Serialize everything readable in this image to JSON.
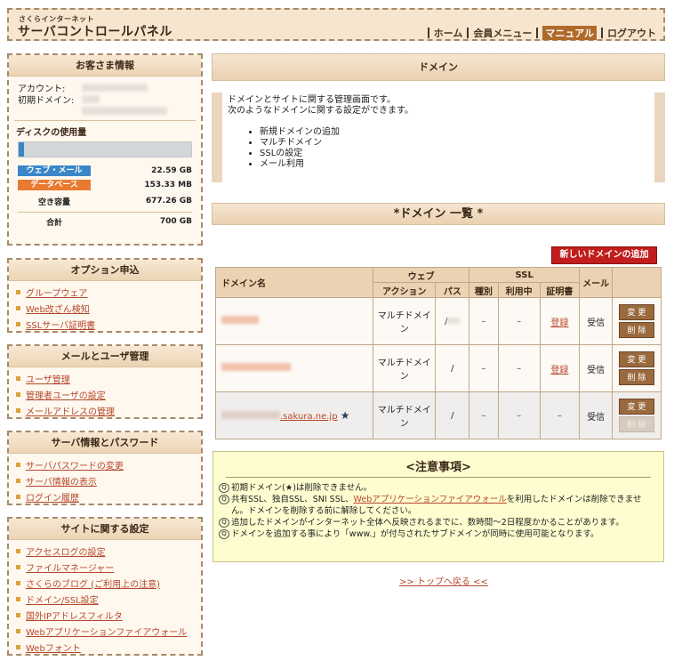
{
  "header": {
    "logo_small": "さくらインターネット",
    "logo_main": "サーバコントロールパネル",
    "nav": [
      {
        "label": "ホーム",
        "active": false
      },
      {
        "label": "会員メニュー",
        "active": false
      },
      {
        "label": "マニュアル",
        "active": true
      },
      {
        "label": "ログアウト",
        "active": false
      }
    ]
  },
  "customer": {
    "title": "お客さま情報",
    "account_label": "アカウント:",
    "initial_domain_label": "初期ドメイン:",
    "disk_title": "ディスクの使用量",
    "disk_usage_fraction": 0.03,
    "disk_rows": [
      {
        "label": "ウェブ・メール",
        "value": "22.59 GB",
        "color": "#3a86c8"
      },
      {
        "label": "データベース",
        "value": "153.33 MB",
        "color": "#e87a30"
      }
    ],
    "free_label": "空き容量",
    "free_value": "677.26 GB",
    "total_label": "合計",
    "total_value": "700 GB"
  },
  "options": {
    "title": "オプション申込",
    "items": [
      "グループウェア",
      "Web改ざん検知",
      "SSLサーバ証明書"
    ]
  },
  "mail_user": {
    "title": "メールとユーザ管理",
    "items": [
      "ユーザ管理",
      "管理者ユーザの設定",
      "メールアドレスの管理"
    ]
  },
  "server_info": {
    "title": "サーバ情報とパスワード",
    "items": [
      "サーバパスワードの変更",
      "サーバ情報の表示",
      "ログイン履歴"
    ]
  },
  "site_settings": {
    "title": "サイトに関する設定",
    "items": [
      "アクセスログの設定",
      "ファイルマネージャー",
      "さくらのブログ (ご利用上の注意)",
      "ドメイン/SSL設定",
      "国外IPアドレスフィルタ",
      "Webアプリケーションファイアウォール",
      "Webフォント"
    ]
  },
  "main": {
    "title": "ドメイン",
    "desc_line1": "ドメインとサイトに関する管理画面です。",
    "desc_line2": "次のようなドメインに関する設定ができます。",
    "features": [
      "新規ドメインの追加",
      "マルチドメイン",
      "SSLの設定",
      "メール利用"
    ],
    "list_title": "*ドメイン 一覧 *",
    "add_button": "新しいドメインの追加"
  },
  "table": {
    "h_domain": "ドメイン名",
    "h_web": "ウェブ",
    "h_ssl": "SSL",
    "h_mail": "メール",
    "h_action": "アクション",
    "h_path": "パス",
    "h_type": "種別",
    "h_inuse": "利用中",
    "h_cert": "証明書",
    "rows": [
      {
        "domain_visible": "",
        "action": "マルチドメイン",
        "path": "/",
        "type": "–",
        "inuse": "–",
        "cert": "登録",
        "mail": "受信",
        "change": "変 更",
        "delete": "削 除"
      },
      {
        "domain_visible": "",
        "action": "マルチドメイン",
        "path": "/",
        "type": "–",
        "inuse": "–",
        "cert": "登録",
        "mail": "受信",
        "change": "変 更",
        "delete": "削 除"
      },
      {
        "domain_visible": ".sakura.ne.jp",
        "action": "マルチドメイン",
        "path": "/",
        "type": "–",
        "inuse": "–",
        "cert": "–",
        "mail": "受信",
        "change": "変 更",
        "delete": "削 除"
      }
    ]
  },
  "notes": {
    "title": "<注意事項>",
    "n1": "初期ドメイン(★)は削除できません。",
    "n2_pre": "共有SSL、独自SSL、SNI SSL、",
    "n2_link": "Webアプリケーションファイアウォール",
    "n2_post": "を利用したドメインは削除できません。ドメインを削除する前に解除してください。",
    "n3": "追加したドメインがインターネット全体へ反映されるまでに、数時間〜2日程度かかることがあります。",
    "n4": "ドメインを追加する事により「www.」が付与されたサブドメインが同時に使用可能となります。"
  },
  "toplink": ">> トップへ戻る <<"
}
